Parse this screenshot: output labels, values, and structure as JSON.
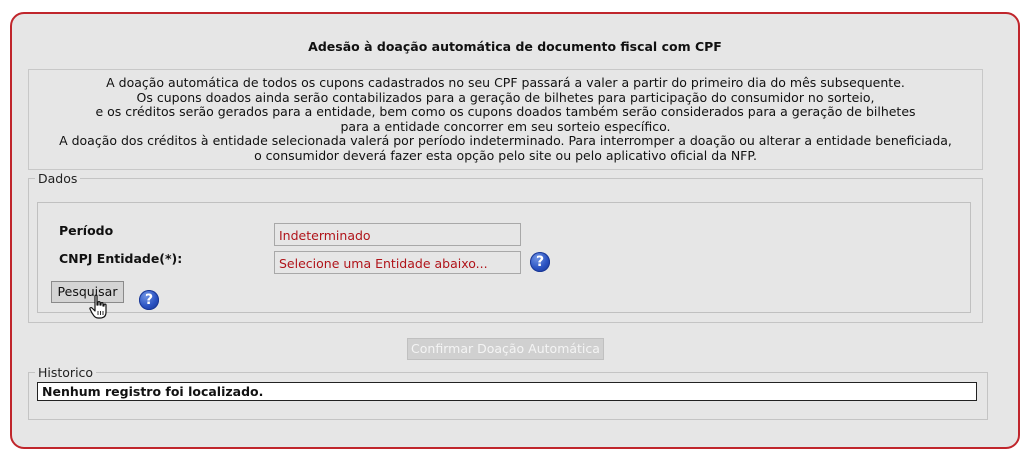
{
  "page": {
    "title": "Adesão à doação automática de documento fiscal com CPF"
  },
  "info": {
    "lines": [
      "A doação automática de todos os cupons cadastrados no seu CPF passará a valer a partir do primeiro dia do mês subsequente.",
      "Os cupons doados ainda serão contabilizados para a geração de bilhetes para participação do consumidor no sorteio,",
      "e os créditos serão gerados para a entidade, bem como os cupons doados também serão considerados para a geração de bilhetes",
      "para a entidade concorrer em seu sorteio específico.",
      "A doação dos créditos à entidade selecionada valerá por período indeterminado. Para interromper a doação ou alterar a entidade beneficiada,",
      "o consumidor deverá fazer esta opção pelo site ou pelo aplicativo oficial da NFP."
    ]
  },
  "dados": {
    "legend": "Dados",
    "periodo_label": "Período",
    "periodo_value": "Indeterminado",
    "cnpj_label": "CNPJ Entidade(*):",
    "cnpj_value": "Selecione uma Entidade abaixo...",
    "help_icon": "question-mark-circle-icon",
    "search_button": "Pesquisar"
  },
  "confirm_button": "Confirmar Doação Automática",
  "historico": {
    "legend": "Historico",
    "message": "Nenhum registro foi localizado."
  },
  "colors": {
    "panel_border": "#c0262c",
    "panel_bg": "#e6e6e6",
    "field_text": "#b0141a",
    "help_icon": "#2a52c2"
  }
}
